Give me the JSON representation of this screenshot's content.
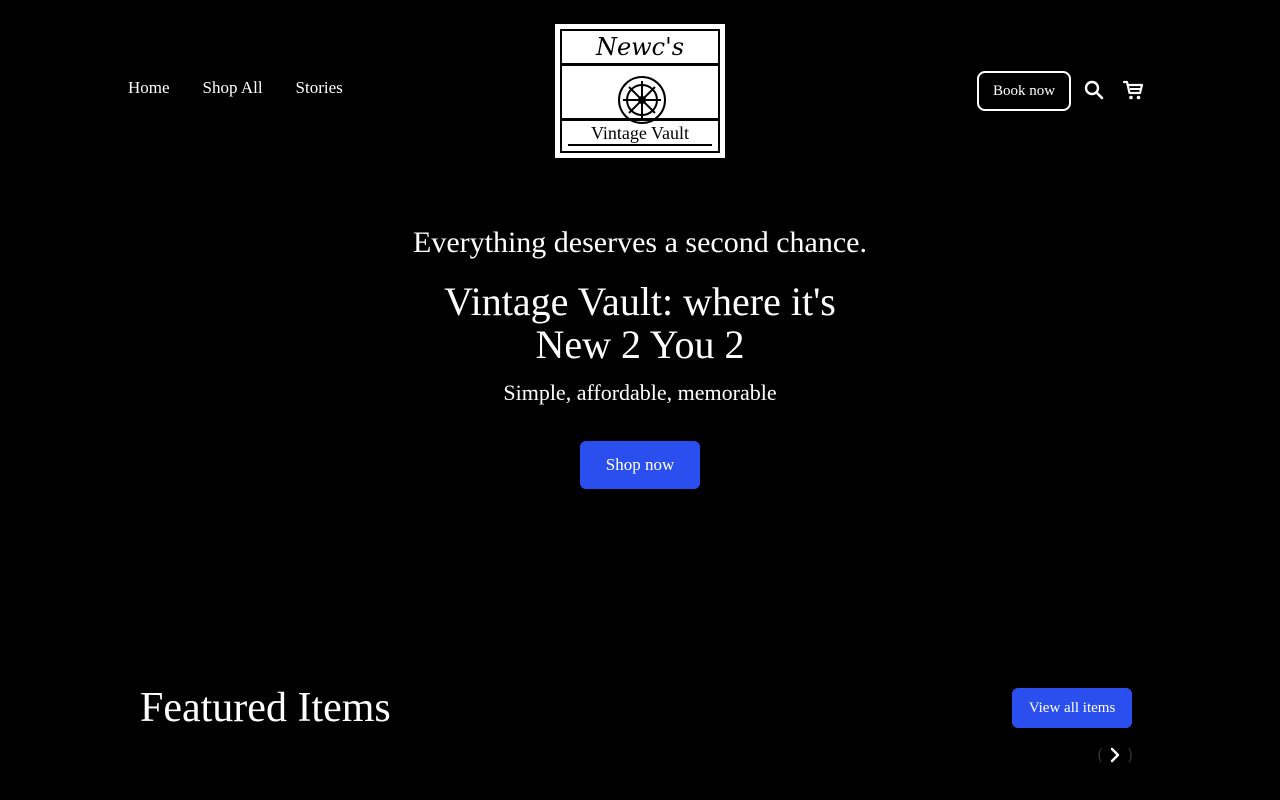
{
  "nav": {
    "items": [
      {
        "label": "Home"
      },
      {
        "label": "Shop All"
      },
      {
        "label": "Stories"
      }
    ]
  },
  "logo": {
    "top_text": "Newc's",
    "bottom_text": "Vintage Vault"
  },
  "header": {
    "book_label": "Book now",
    "search_icon": "search-icon",
    "cart_icon": "cart-icon"
  },
  "hero": {
    "subheading": "Everything deserves a second chance.",
    "title_line1": "Vintage Vault: where it's",
    "title_line2": "New 2 You 2",
    "tagline": "Simple, affordable, memorable",
    "cta_label": "Shop now"
  },
  "featured": {
    "title": "Featured Items",
    "view_all_label": "View all items"
  },
  "colors": {
    "background": "#000000",
    "text": "#ffffff",
    "accent": "#2b4fef"
  }
}
